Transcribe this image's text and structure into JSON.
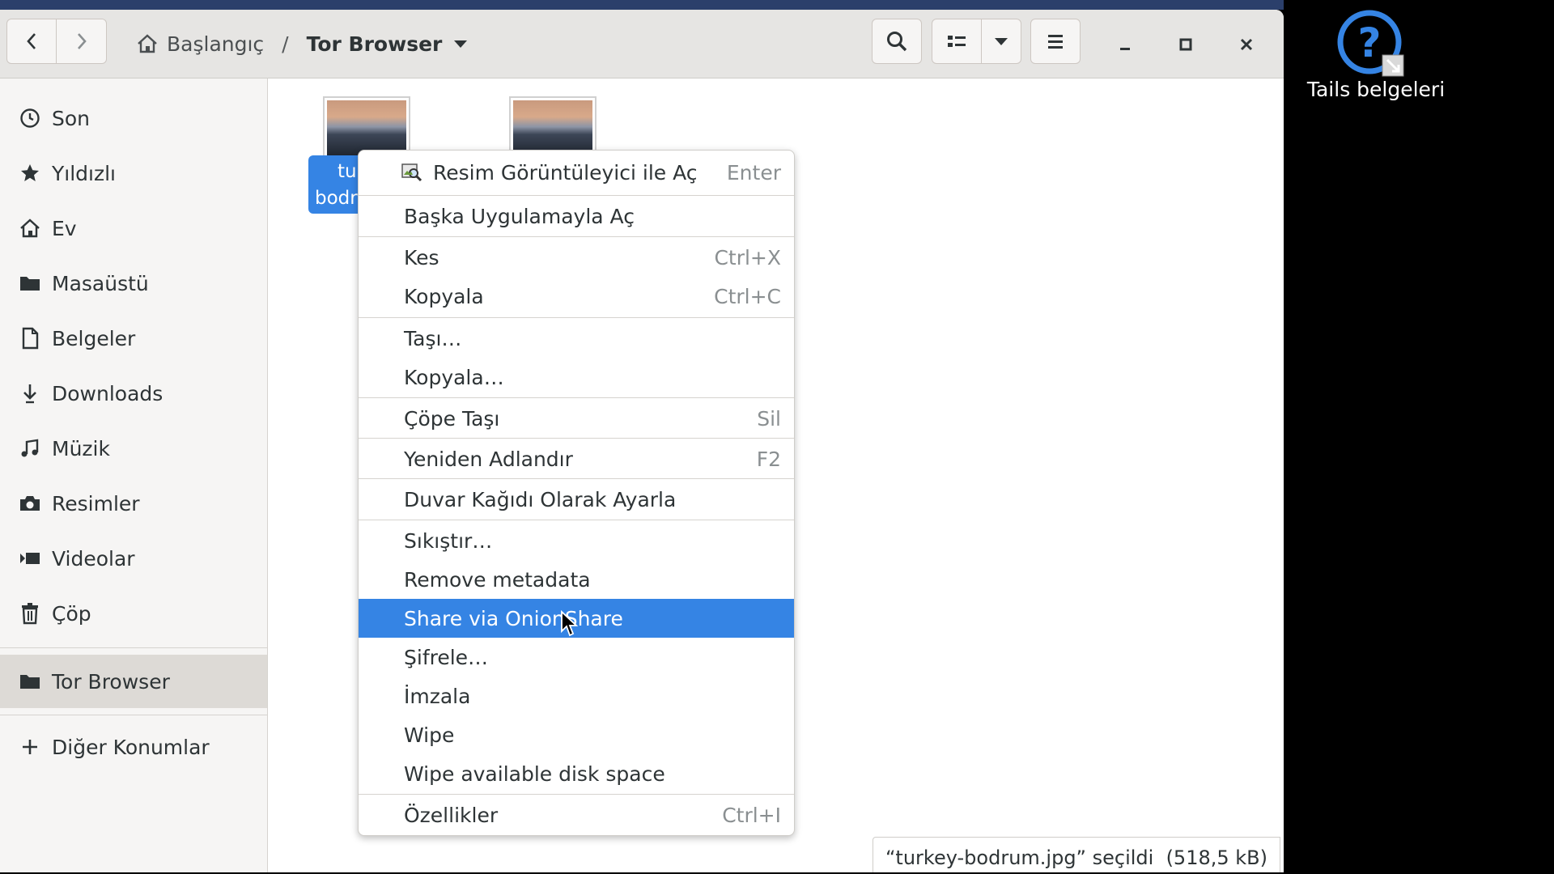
{
  "window": {
    "breadcrumb": {
      "home_label": "Başlangıç",
      "separator": "/",
      "current": "Tor Browser"
    }
  },
  "sidebar": {
    "items": [
      {
        "label": "Son",
        "icon": "clock-icon"
      },
      {
        "label": "Yıldızlı",
        "icon": "star-icon"
      },
      {
        "label": "Ev",
        "icon": "home-icon"
      },
      {
        "label": "Masaüstü",
        "icon": "folder-icon"
      },
      {
        "label": "Belgeler",
        "icon": "document-icon"
      },
      {
        "label": "Downloads",
        "icon": "download-icon"
      },
      {
        "label": "Müzik",
        "icon": "music-icon"
      },
      {
        "label": "Resimler",
        "icon": "camera-icon"
      },
      {
        "label": "Videolar",
        "icon": "video-icon"
      },
      {
        "label": "Çöp",
        "icon": "trash-icon"
      }
    ],
    "active": {
      "label": "Tor Browser",
      "icon": "folder-icon"
    },
    "other": {
      "label": "Diğer Konumlar",
      "icon": "plus-icon"
    }
  },
  "files": {
    "selected_label_line1": "tur",
    "selected_label_line2": "bodr"
  },
  "context_menu": {
    "items": [
      {
        "label": "Resim Görüntüleyici ile Aç",
        "accel": "Enter",
        "icon": "image-viewer-icon"
      },
      {
        "label": "Başka Uygulamayla Aç",
        "accel": ""
      },
      {
        "label": "Kes",
        "accel": "Ctrl+X"
      },
      {
        "label": "Kopyala",
        "accel": "Ctrl+C"
      },
      {
        "label": "Taşı…",
        "accel": ""
      },
      {
        "label": "Kopyala…",
        "accel": ""
      },
      {
        "label": "Çöpe Taşı",
        "accel": "Sil"
      },
      {
        "label": "Yeniden Adlandır",
        "accel": "F2"
      },
      {
        "label": "Duvar Kağıdı Olarak Ayarla",
        "accel": ""
      },
      {
        "label": "Sıkıştır…",
        "accel": ""
      },
      {
        "label": "Remove metadata",
        "accel": ""
      },
      {
        "label": "Share via OnionShare",
        "accel": "",
        "highlighted": true
      },
      {
        "label": "Şifrele…",
        "accel": ""
      },
      {
        "label": "İmzala",
        "accel": ""
      },
      {
        "label": "Wipe",
        "accel": ""
      },
      {
        "label": "Wipe available disk space",
        "accel": ""
      },
      {
        "label": "Özellikler",
        "accel": "Ctrl+I"
      }
    ]
  },
  "status": {
    "text": "“turkey-bodrum.jpg” seçildi  (518,5 kB)"
  },
  "desktop": {
    "icon_label": "Tails belgeleri",
    "icon": "help-icon"
  },
  "colors": {
    "accent": "#3584e4",
    "headerbar": "#e6e5e3",
    "sidebar": "#f6f5f4",
    "topstrip": "#2b3f6b"
  }
}
